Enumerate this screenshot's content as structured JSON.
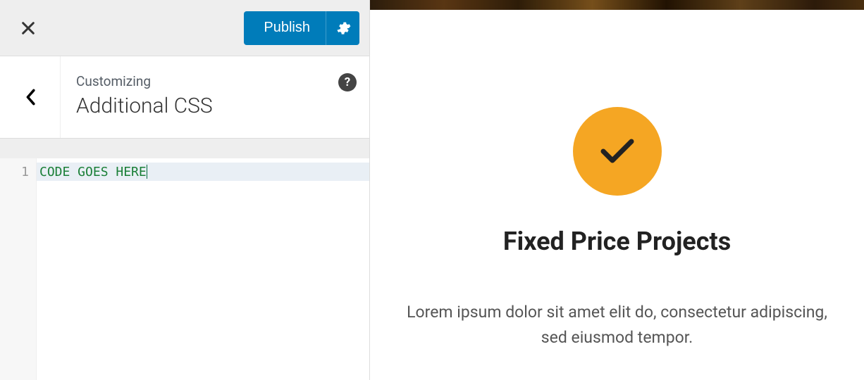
{
  "header": {
    "publish_label": "Publish"
  },
  "panel": {
    "breadcrumb": "Customizing",
    "title": "Additional CSS",
    "help_label": "?"
  },
  "editor": {
    "line_numbers": [
      "1"
    ],
    "code": "CODE GOES HERE"
  },
  "preview": {
    "feature_title": "Fixed Price Projects",
    "feature_desc": "Lorem ipsum dolor sit amet elit do, consectetur adipiscing, sed eiusmod tempor."
  }
}
